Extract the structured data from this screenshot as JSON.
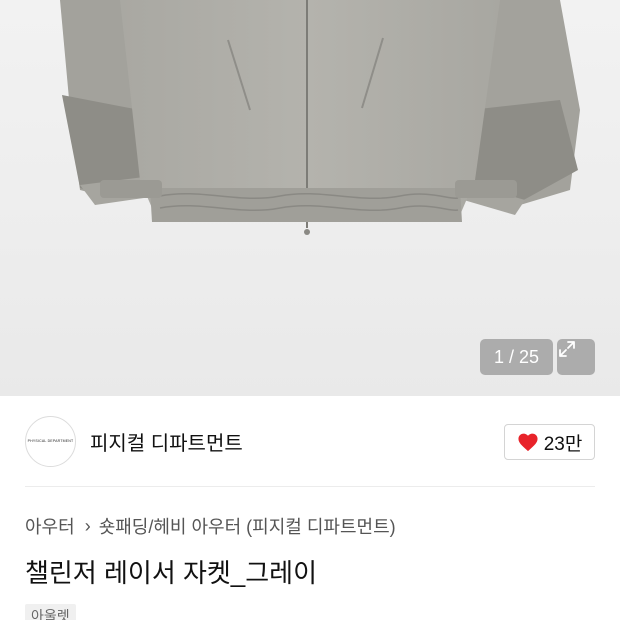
{
  "gallery": {
    "counter": "1 / 25",
    "current_page": 1,
    "total_pages": 25
  },
  "brand": {
    "logo_text": "PHYSICAL DEPARTMENT",
    "name": "피지컬 디파트먼트"
  },
  "like": {
    "count": "23만",
    "icon": "heart-icon",
    "color": "#e8232a"
  },
  "breadcrumb": {
    "category": "아우터",
    "subcategory": "숏패딩/헤비 아우터 (피지컬 디파트먼트)"
  },
  "product": {
    "title": "챌린저 레이서 자켓_그레이",
    "tag": "아울렛"
  }
}
